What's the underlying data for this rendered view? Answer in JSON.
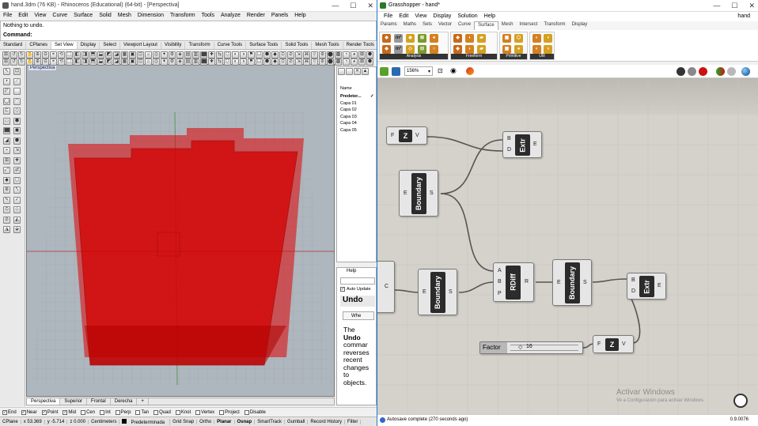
{
  "rhino": {
    "title": "hand.3dm (76 KB) - Rhinoceros (Educational) (64-bit) - [Perspectiva]",
    "menu": [
      "File",
      "Edit",
      "View",
      "Curve",
      "Surface",
      "Solid",
      "Mesh",
      "Dimension",
      "Transform",
      "Tools",
      "Analyze",
      "Render",
      "Panels",
      "Help"
    ],
    "command_history": "Nothing to undo.",
    "command_prompt": "Command:",
    "toolbar_tabs": [
      "Standard",
      "CPlanes",
      "Set View",
      "Display",
      "Select",
      "Viewport Layout",
      "Visibility",
      "Transform",
      "Curve Tools",
      "Surface Tools",
      "Solid Tools",
      "Mesh Tools",
      "Render Tools",
      "Draf"
    ],
    "active_toolbar_tab": "Set View",
    "viewport_label": "Perspectiva",
    "viewport_tabs": [
      "Perspectiva",
      "Superior",
      "Frontal",
      "Derecha"
    ],
    "active_viewport_tab": "Perspectiva",
    "osnaps": [
      {
        "label": "End",
        "checked": true
      },
      {
        "label": "Near",
        "checked": true
      },
      {
        "label": "Point",
        "checked": true
      },
      {
        "label": "Mid",
        "checked": true
      },
      {
        "label": "Cen",
        "checked": false
      },
      {
        "label": "Int",
        "checked": false
      },
      {
        "label": "Perp",
        "checked": false
      },
      {
        "label": "Tan",
        "checked": false
      },
      {
        "label": "Quad",
        "checked": false
      },
      {
        "label": "Knot",
        "checked": false
      },
      {
        "label": "Vertex",
        "checked": false
      },
      {
        "label": "Project",
        "checked": false
      },
      {
        "label": "Disable",
        "checked": false
      }
    ],
    "status": {
      "cplane": "CPlane",
      "x": "x 53.369",
      "y": "y -5.714",
      "z": "z 0.000",
      "units": "Centimeters",
      "layer": "Predeterminada",
      "toggles": [
        "Grid Snap",
        "Ortho",
        "Planar",
        "Osnap",
        "SmartTrack",
        "Gumball",
        "Record History",
        "Filter"
      ]
    },
    "layers": {
      "header": "Name",
      "items": [
        "Predeter...",
        "Capa 01",
        "Capa 02",
        "Capa 03",
        "Capa 04",
        "Capa 05"
      ]
    },
    "help": {
      "tab": "Help",
      "auto_update": "Auto Update",
      "title": "Undo",
      "button": "Whe",
      "lines": [
        "The",
        "Undo",
        "commar",
        "reverses",
        "recent",
        "changes",
        "to",
        "objects."
      ]
    }
  },
  "grasshopper": {
    "title": "Grasshopper - hand*",
    "doc_name": "hand",
    "menu": [
      "File",
      "Edit",
      "View",
      "Display",
      "Solution",
      "Help"
    ],
    "tabs": [
      "Params",
      "Maths",
      "Sets",
      "Vector",
      "Curve",
      "Surface",
      "Mesh",
      "Intersect",
      "Transform",
      "Display"
    ],
    "active_tab": "Surface",
    "ribbon_groups": [
      "Analysis",
      "Freeform",
      "Primitive",
      "Util"
    ],
    "zoom": "156%",
    "components": {
      "z1": {
        "label": "Z",
        "in": "F",
        "out": "V"
      },
      "extr1": {
        "label": "Extr",
        "in": [
          "B",
          "D"
        ],
        "out": "E"
      },
      "bound1": {
        "label": "Boundary",
        "in": "E",
        "out": "S"
      },
      "left": {
        "out": "C"
      },
      "bound2": {
        "label": "Boundary",
        "in": "E",
        "out": "S"
      },
      "rdiff": {
        "label": "RDiff",
        "in": [
          "A",
          "B",
          "P"
        ],
        "out": "R"
      },
      "bound3": {
        "label": "Boundary",
        "in": "E",
        "out": "S"
      },
      "extr2": {
        "label": "Extr",
        "in": [
          "B",
          "D"
        ],
        "out": "E"
      },
      "z2": {
        "label": "Z",
        "in": "F",
        "out": "V"
      },
      "slider": {
        "label": "Factor",
        "value": "16"
      }
    },
    "status": "Autosave complete (270 seconds ago)",
    "version": "0.9.0076",
    "watermark": {
      "line1": "Activar Windows",
      "line2": "Ve a Configuración para activar Windows."
    }
  },
  "colors": {
    "solid_red": "#e00000",
    "gh_canvas": "#d4d2ca",
    "component_body": "#2b2b2b"
  }
}
